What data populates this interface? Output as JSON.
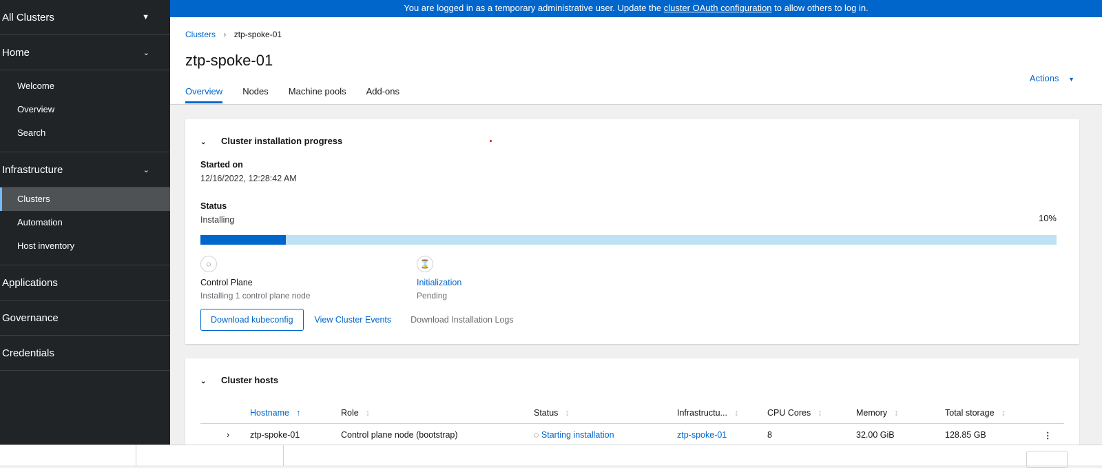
{
  "sidebar": {
    "cluster_switcher": "All Clusters",
    "sections": [
      {
        "label": "Home",
        "items": [
          "Welcome",
          "Overview",
          "Search"
        ]
      },
      {
        "label": "Infrastructure",
        "items": [
          "Clusters",
          "Automation",
          "Host inventory"
        ],
        "active": "Clusters"
      },
      {
        "label": "Applications"
      },
      {
        "label": "Governance"
      },
      {
        "label": "Credentials"
      }
    ]
  },
  "banner": {
    "prefix": "You are logged in as a temporary administrative user. Update the ",
    "link": "cluster OAuth configuration",
    "suffix": " to allow others to log in."
  },
  "header": {
    "breadcrumb": [
      "Clusters",
      "ztp-spoke-01"
    ],
    "title": "ztp-spoke-01",
    "tabs": [
      "Overview",
      "Nodes",
      "Machine pools",
      "Add-ons"
    ],
    "actions": "Actions"
  },
  "progress": {
    "title": "Cluster installation progress",
    "started_label": "Started on",
    "started_value": "12/16/2022, 12:28:42 AM",
    "status_label": "Status",
    "status_value": "Installing",
    "percent_text": "10%",
    "percent": 10,
    "steps": [
      {
        "name": "Control Plane",
        "sub": "Installing 1 control plane node"
      },
      {
        "name": "Initialization",
        "sub": "Pending"
      }
    ],
    "buttons": {
      "kubeconfig": "Download kubeconfig",
      "events": "View Cluster Events",
      "logs": "Download Installation Logs"
    }
  },
  "hosts": {
    "title": "Cluster hosts",
    "columns": [
      "Hostname",
      "Role",
      "Status",
      "Infrastructu...",
      "CPU Cores",
      "Memory",
      "Total storage"
    ],
    "rows": [
      {
        "hostname": "ztp-spoke-01",
        "role": "Control plane node (bootstrap)",
        "status": "Starting installation",
        "infra": "ztp-spoke-01",
        "cpu": "8",
        "memory": "32.00 GiB",
        "storage": "128.85 GB"
      }
    ]
  },
  "colors": {
    "accent": "#0066cc",
    "sidebar": "#212427"
  }
}
